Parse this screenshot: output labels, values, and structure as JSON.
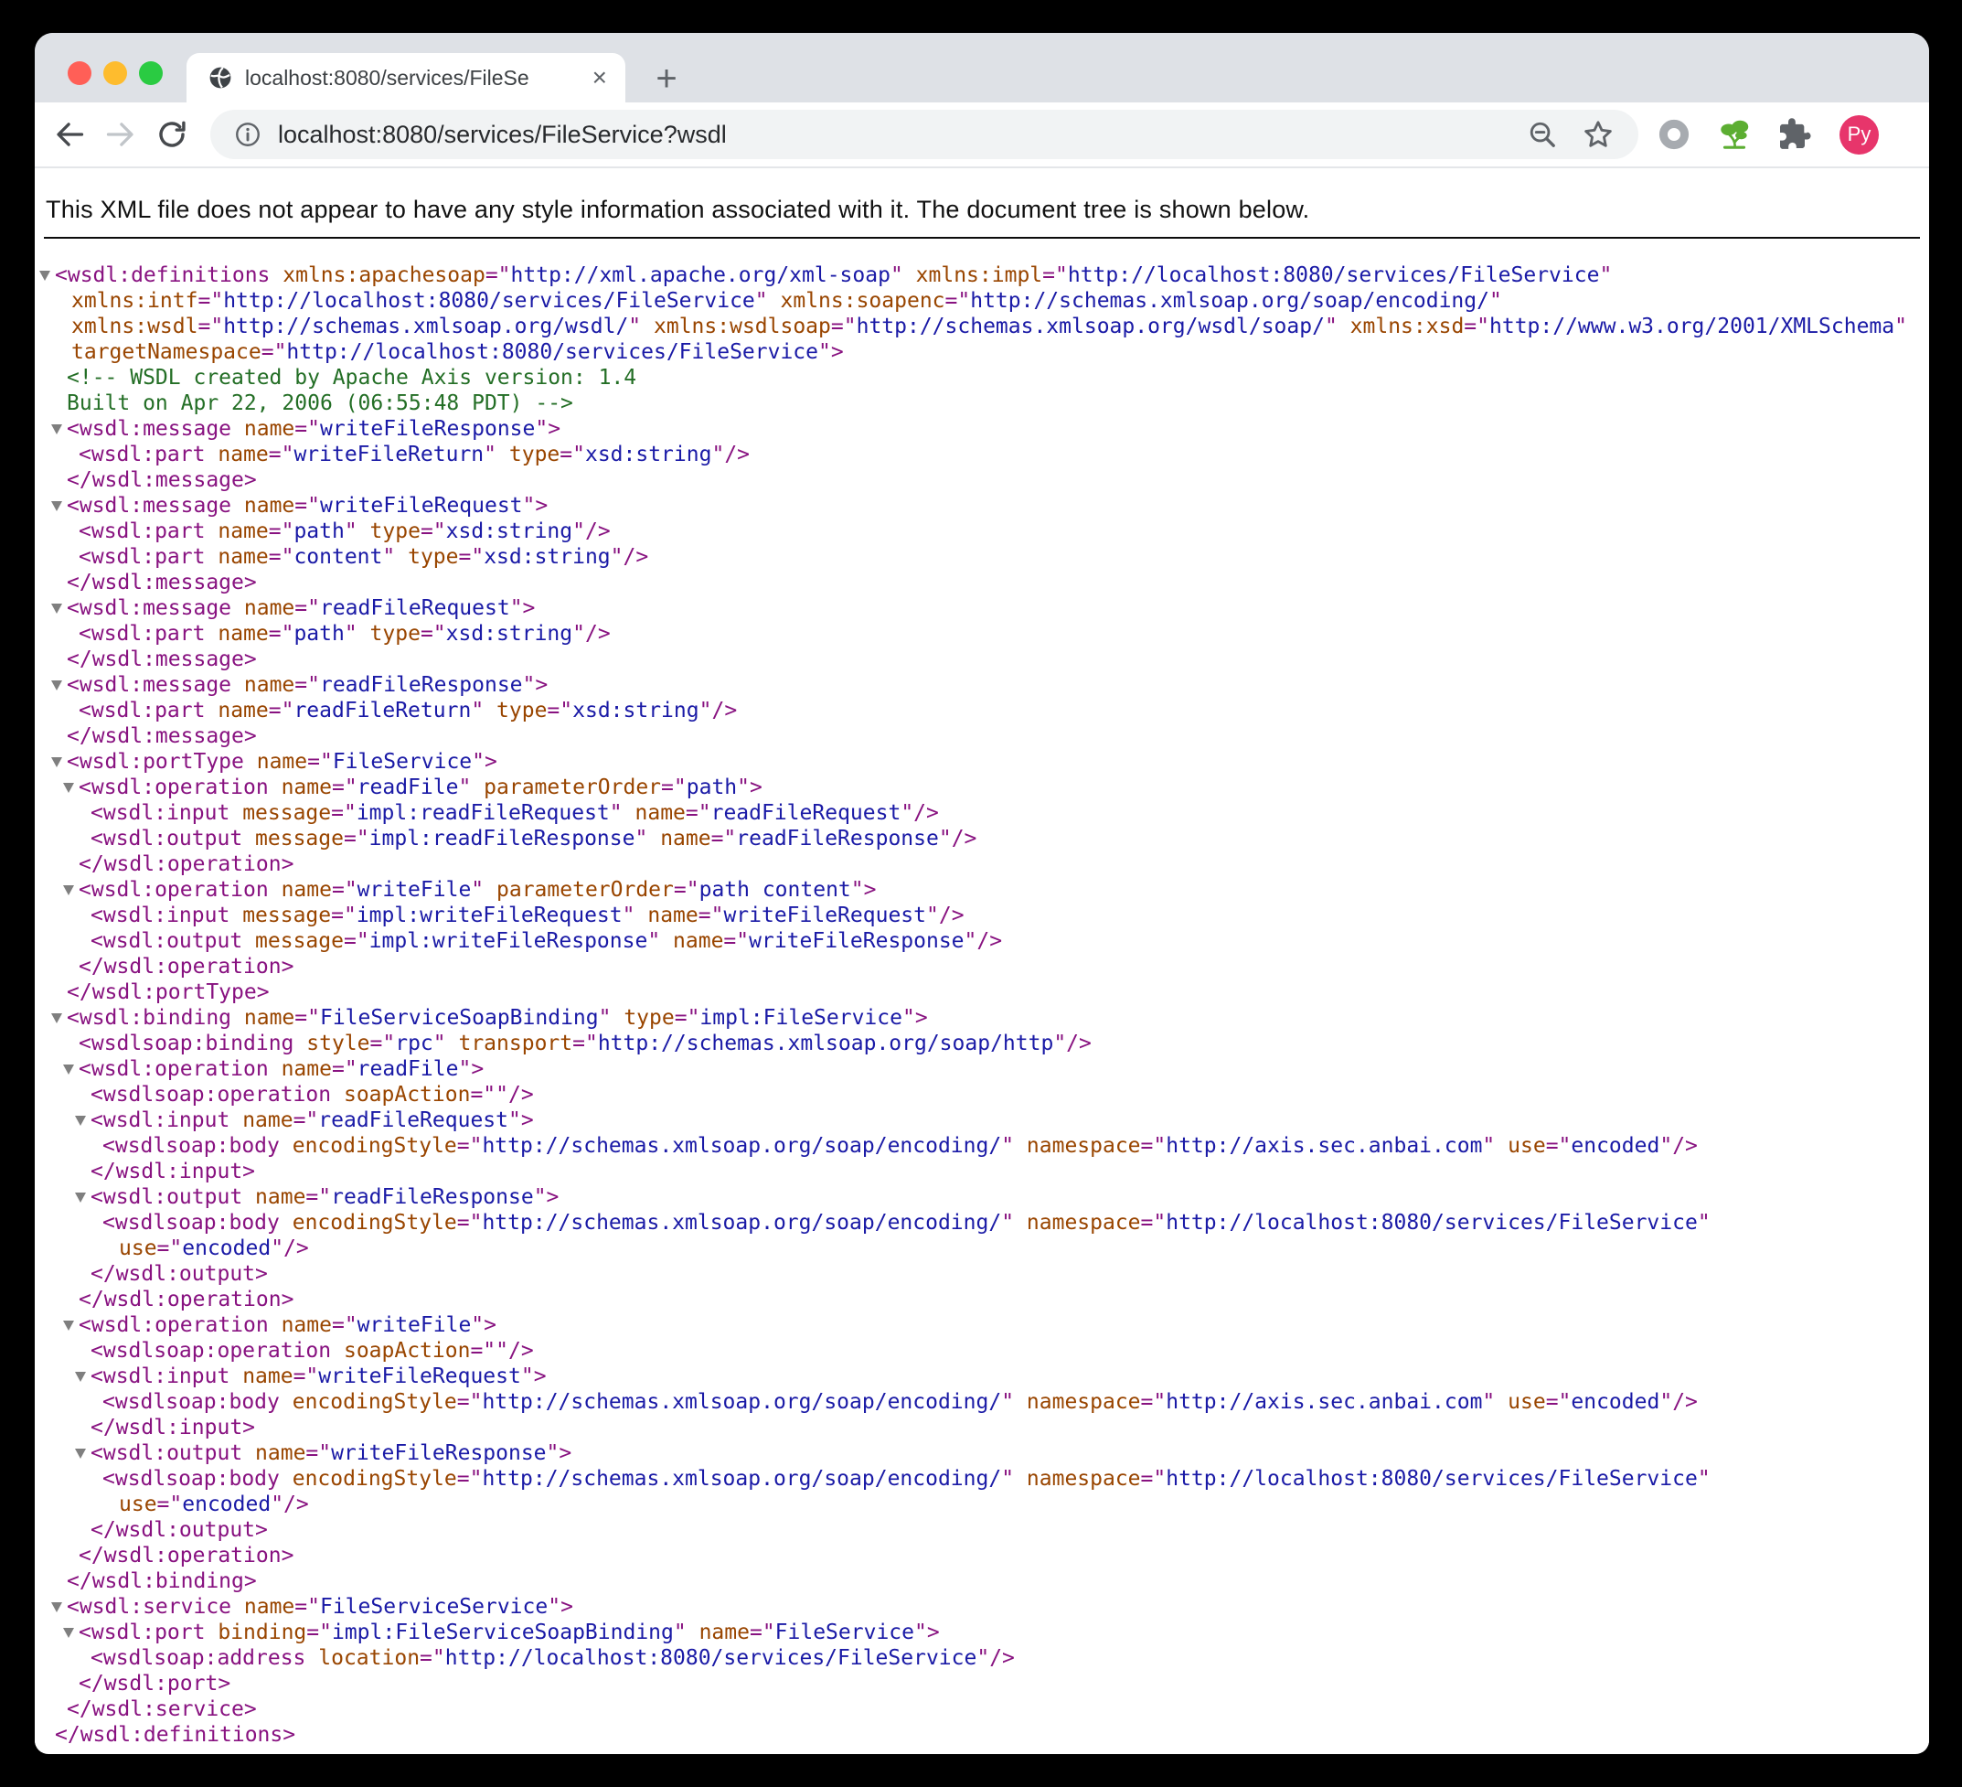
{
  "browser": {
    "tab": {
      "title": "localhost:8080/services/FileSe",
      "close_label": "×"
    },
    "new_tab_label": "+",
    "url": "localhost:8080/services/FileService?wsdl",
    "avatar_label": "Py"
  },
  "notice": "This XML file does not appear to have any style information associated with it. The document tree is shown below.",
  "colors": {
    "tag": "#881280",
    "attr_name": "#994500",
    "attr_value": "#1A1AA6",
    "comment": "#236E25",
    "avatar_bg": "#E7356B",
    "tree_green": "#5CAE32"
  },
  "xml_lines": [
    {
      "l": 0,
      "a": 1,
      "t": "<wsdl:definitions xmlns:apachesoap=\"http://xml.apache.org/xml-soap\" xmlns:impl=\"http://localhost:8080/services/FileService\""
    },
    {
      "l": 0,
      "w": 1,
      "t": "xmlns:intf=\"http://localhost:8080/services/FileService\" xmlns:soapenc=\"http://schemas.xmlsoap.org/soap/encoding/\""
    },
    {
      "l": 0,
      "w": 1,
      "t": "xmlns:wsdl=\"http://schemas.xmlsoap.org/wsdl/\" xmlns:wsdlsoap=\"http://schemas.xmlsoap.org/wsdl/soap/\" xmlns:xsd=\"http://www.w3.org/2001/XMLSchema\""
    },
    {
      "l": 0,
      "w": 1,
      "t": "targetNamespace=\"http://localhost:8080/services/FileService\">"
    },
    {
      "l": 1,
      "c": 1,
      "t": "<!-- WSDL created by Apache Axis version: 1.4"
    },
    {
      "l": 1,
      "c": 1,
      "t": "Built on Apr 22, 2006 (06:55:48 PDT) -->"
    },
    {
      "l": 1,
      "a": 1,
      "t": "<wsdl:message name=\"writeFileResponse\">"
    },
    {
      "l": 2,
      "t": "<wsdl:part name=\"writeFileReturn\" type=\"xsd:string\"/>"
    },
    {
      "l": 1,
      "t": "</wsdl:message>"
    },
    {
      "l": 1,
      "a": 1,
      "t": "<wsdl:message name=\"writeFileRequest\">"
    },
    {
      "l": 2,
      "t": "<wsdl:part name=\"path\" type=\"xsd:string\"/>"
    },
    {
      "l": 2,
      "t": "<wsdl:part name=\"content\" type=\"xsd:string\"/>"
    },
    {
      "l": 1,
      "t": "</wsdl:message>"
    },
    {
      "l": 1,
      "a": 1,
      "t": "<wsdl:message name=\"readFileRequest\">"
    },
    {
      "l": 2,
      "t": "<wsdl:part name=\"path\" type=\"xsd:string\"/>"
    },
    {
      "l": 1,
      "t": "</wsdl:message>"
    },
    {
      "l": 1,
      "a": 1,
      "t": "<wsdl:message name=\"readFileResponse\">"
    },
    {
      "l": 2,
      "t": "<wsdl:part name=\"readFileReturn\" type=\"xsd:string\"/>"
    },
    {
      "l": 1,
      "t": "</wsdl:message>"
    },
    {
      "l": 1,
      "a": 1,
      "t": "<wsdl:portType name=\"FileService\">"
    },
    {
      "l": 2,
      "a": 1,
      "t": "<wsdl:operation name=\"readFile\" parameterOrder=\"path\">"
    },
    {
      "l": 3,
      "t": "<wsdl:input message=\"impl:readFileRequest\" name=\"readFileRequest\"/>"
    },
    {
      "l": 3,
      "t": "<wsdl:output message=\"impl:readFileResponse\" name=\"readFileResponse\"/>"
    },
    {
      "l": 2,
      "t": "</wsdl:operation>"
    },
    {
      "l": 2,
      "a": 1,
      "t": "<wsdl:operation name=\"writeFile\" parameterOrder=\"path content\">"
    },
    {
      "l": 3,
      "t": "<wsdl:input message=\"impl:writeFileRequest\" name=\"writeFileRequest\"/>"
    },
    {
      "l": 3,
      "t": "<wsdl:output message=\"impl:writeFileResponse\" name=\"writeFileResponse\"/>"
    },
    {
      "l": 2,
      "t": "</wsdl:operation>"
    },
    {
      "l": 1,
      "t": "</wsdl:portType>"
    },
    {
      "l": 1,
      "a": 1,
      "t": "<wsdl:binding name=\"FileServiceSoapBinding\" type=\"impl:FileService\">"
    },
    {
      "l": 2,
      "t": "<wsdlsoap:binding style=\"rpc\" transport=\"http://schemas.xmlsoap.org/soap/http\"/>"
    },
    {
      "l": 2,
      "a": 1,
      "t": "<wsdl:operation name=\"readFile\">"
    },
    {
      "l": 3,
      "t": "<wsdlsoap:operation soapAction=\"\"/>"
    },
    {
      "l": 3,
      "a": 1,
      "t": "<wsdl:input name=\"readFileRequest\">"
    },
    {
      "l": 4,
      "t": "<wsdlsoap:body encodingStyle=\"http://schemas.xmlsoap.org/soap/encoding/\" namespace=\"http://axis.sec.anbai.com\" use=\"encoded\"/>"
    },
    {
      "l": 3,
      "t": "</wsdl:input>"
    },
    {
      "l": 3,
      "a": 1,
      "t": "<wsdl:output name=\"readFileResponse\">"
    },
    {
      "l": 4,
      "t": "<wsdlsoap:body encodingStyle=\"http://schemas.xmlsoap.org/soap/encoding/\" namespace=\"http://localhost:8080/services/FileService\""
    },
    {
      "l": 4,
      "w": 1,
      "t": "use=\"encoded\"/>"
    },
    {
      "l": 3,
      "t": "</wsdl:output>"
    },
    {
      "l": 2,
      "t": "</wsdl:operation>"
    },
    {
      "l": 2,
      "a": 1,
      "t": "<wsdl:operation name=\"writeFile\">"
    },
    {
      "l": 3,
      "t": "<wsdlsoap:operation soapAction=\"\"/>"
    },
    {
      "l": 3,
      "a": 1,
      "t": "<wsdl:input name=\"writeFileRequest\">"
    },
    {
      "l": 4,
      "t": "<wsdlsoap:body encodingStyle=\"http://schemas.xmlsoap.org/soap/encoding/\" namespace=\"http://axis.sec.anbai.com\" use=\"encoded\"/>"
    },
    {
      "l": 3,
      "t": "</wsdl:input>"
    },
    {
      "l": 3,
      "a": 1,
      "t": "<wsdl:output name=\"writeFileResponse\">"
    },
    {
      "l": 4,
      "t": "<wsdlsoap:body encodingStyle=\"http://schemas.xmlsoap.org/soap/encoding/\" namespace=\"http://localhost:8080/services/FileService\""
    },
    {
      "l": 4,
      "w": 1,
      "t": "use=\"encoded\"/>"
    },
    {
      "l": 3,
      "t": "</wsdl:output>"
    },
    {
      "l": 2,
      "t": "</wsdl:operation>"
    },
    {
      "l": 1,
      "t": "</wsdl:binding>"
    },
    {
      "l": 1,
      "a": 1,
      "t": "<wsdl:service name=\"FileServiceService\">"
    },
    {
      "l": 2,
      "a": 1,
      "t": "<wsdl:port binding=\"impl:FileServiceSoapBinding\" name=\"FileService\">"
    },
    {
      "l": 3,
      "t": "<wsdlsoap:address location=\"http://localhost:8080/services/FileService\"/>"
    },
    {
      "l": 2,
      "t": "</wsdl:port>"
    },
    {
      "l": 1,
      "t": "</wsdl:service>"
    },
    {
      "l": 0,
      "t": "</wsdl:definitions>"
    }
  ]
}
